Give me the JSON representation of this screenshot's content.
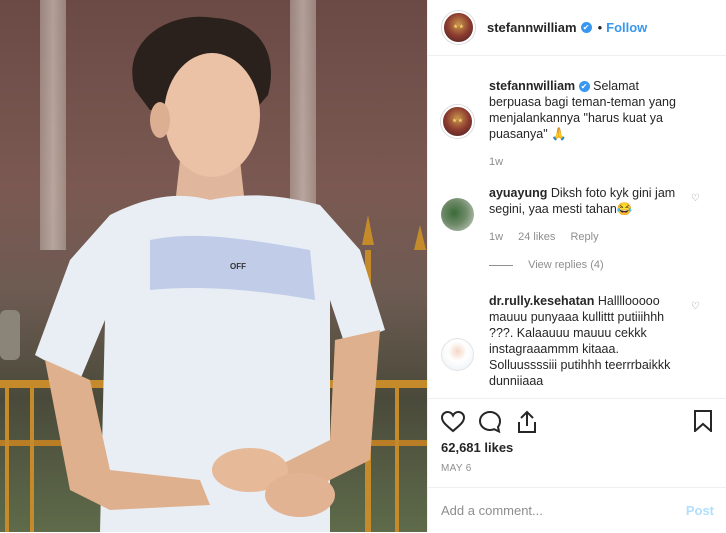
{
  "header": {
    "username": "stefannwilliam",
    "verified_badge": "✔",
    "separator": "•",
    "follow_label": "Follow"
  },
  "caption": {
    "username": "stefannwilliam",
    "text": "Selamat berpuasa bagi teman-teman yang menjalankannya \"harus kuat ya puasanya\" 🙏",
    "time": "1w"
  },
  "comments": [
    {
      "username": "ayuayung",
      "text": "Diksh foto kyk gini jam segini, yaa mesti tahan😂",
      "time": "1w",
      "likes": "24 likes",
      "reply": "Reply",
      "view_replies": "View replies (4)"
    },
    {
      "username": "dr.rully.kesehatan",
      "text": "Hallllooooo mauuu punyaaa kullittt putiiihhh ???. Kalaauuu mauuu cekkk instagraaammm kitaaa. Solluussssiii putihhh teerrrbaikkk dunniiaaa"
    }
  ],
  "post": {
    "likes": "62,681 likes",
    "date": "MAY 6",
    "shirt_logo": "OFF"
  },
  "add_comment": {
    "placeholder": "Add a comment...",
    "post_label": "Post"
  },
  "icons": {
    "like": "heart-icon",
    "comment": "comment-icon",
    "share": "share-icon",
    "save": "bookmark-icon"
  },
  "colors": {
    "link_blue": "#3897f0",
    "muted": "#8e8e8e",
    "text": "#262626",
    "post_disabled": "#b2dffc"
  }
}
